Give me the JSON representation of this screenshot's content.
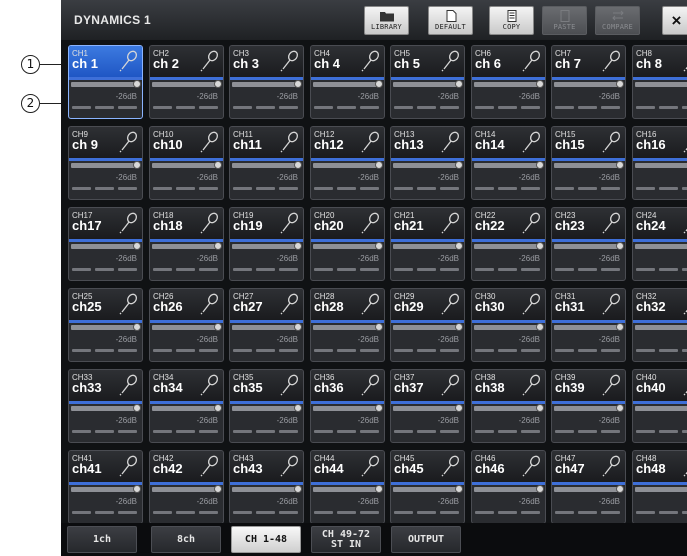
{
  "callouts": [
    "1",
    "2"
  ],
  "panel": {
    "title": "DYNAMICS 1"
  },
  "toolbar": {
    "buttons": [
      {
        "label": "LIBRARY",
        "icon": "folder-icon",
        "enabled": true
      },
      {
        "label": "DEFAULT",
        "icon": "document-icon",
        "enabled": true
      },
      {
        "label": "COPY",
        "icon": "clipboard-icon",
        "enabled": true
      },
      {
        "label": "PASTE",
        "icon": "paste-icon",
        "enabled": false
      },
      {
        "label": "COMPARE",
        "icon": "compare-icon",
        "enabled": false
      }
    ],
    "close_label": "×"
  },
  "channels": [
    {
      "id": "CH1",
      "name": "ch 1",
      "db": "-26dB",
      "selected": true
    },
    {
      "id": "CH2",
      "name": "ch 2",
      "db": "-26dB"
    },
    {
      "id": "CH3",
      "name": "ch 3",
      "db": "-26dB"
    },
    {
      "id": "CH4",
      "name": "ch 4",
      "db": "-26dB"
    },
    {
      "id": "CH5",
      "name": "ch 5",
      "db": "-26dB"
    },
    {
      "id": "CH6",
      "name": "ch 6",
      "db": "-26dB"
    },
    {
      "id": "CH7",
      "name": "ch 7",
      "db": "-26dB"
    },
    {
      "id": "CH8",
      "name": "ch 8",
      "db": "-26"
    },
    {
      "id": "CH9",
      "name": "ch 9",
      "db": "-26dB"
    },
    {
      "id": "CH10",
      "name": "ch10",
      "db": "-26dB"
    },
    {
      "id": "CH11",
      "name": "ch11",
      "db": "-26dB"
    },
    {
      "id": "CH12",
      "name": "ch12",
      "db": "-26dB"
    },
    {
      "id": "CH13",
      "name": "ch13",
      "db": "-26dB"
    },
    {
      "id": "CH14",
      "name": "ch14",
      "db": "-26dB"
    },
    {
      "id": "CH15",
      "name": "ch15",
      "db": "-26dB"
    },
    {
      "id": "CH16",
      "name": "ch16",
      "db": "-26"
    },
    {
      "id": "CH17",
      "name": "ch17",
      "db": "-26dB"
    },
    {
      "id": "CH18",
      "name": "ch18",
      "db": "-26dB"
    },
    {
      "id": "CH19",
      "name": "ch19",
      "db": "-26dB"
    },
    {
      "id": "CH20",
      "name": "ch20",
      "db": "-26dB"
    },
    {
      "id": "CH21",
      "name": "ch21",
      "db": "-26dB"
    },
    {
      "id": "CH22",
      "name": "ch22",
      "db": "-26dB"
    },
    {
      "id": "CH23",
      "name": "ch23",
      "db": "-26dB"
    },
    {
      "id": "CH24",
      "name": "ch24",
      "db": "-26"
    },
    {
      "id": "CH25",
      "name": "ch25",
      "db": "-26dB"
    },
    {
      "id": "CH26",
      "name": "ch26",
      "db": "-26dB"
    },
    {
      "id": "CH27",
      "name": "ch27",
      "db": "-26dB"
    },
    {
      "id": "CH28",
      "name": "ch28",
      "db": "-26dB"
    },
    {
      "id": "CH29",
      "name": "ch29",
      "db": "-26dB"
    },
    {
      "id": "CH30",
      "name": "ch30",
      "db": "-26dB"
    },
    {
      "id": "CH31",
      "name": "ch31",
      "db": "-26dB"
    },
    {
      "id": "CH32",
      "name": "ch32",
      "db": "-26"
    },
    {
      "id": "CH33",
      "name": "ch33",
      "db": "-26dB"
    },
    {
      "id": "CH34",
      "name": "ch34",
      "db": "-26dB"
    },
    {
      "id": "CH35",
      "name": "ch35",
      "db": "-26dB"
    },
    {
      "id": "CH36",
      "name": "ch36",
      "db": "-26dB"
    },
    {
      "id": "CH37",
      "name": "ch37",
      "db": "-26dB"
    },
    {
      "id": "CH38",
      "name": "ch38",
      "db": "-26dB"
    },
    {
      "id": "CH39",
      "name": "ch39",
      "db": "-26dB"
    },
    {
      "id": "CH40",
      "name": "ch40",
      "db": "-26"
    },
    {
      "id": "CH41",
      "name": "ch41",
      "db": "-26dB"
    },
    {
      "id": "CH42",
      "name": "ch42",
      "db": "-26dB"
    },
    {
      "id": "CH43",
      "name": "ch43",
      "db": "-26dB"
    },
    {
      "id": "CH44",
      "name": "ch44",
      "db": "-26dB"
    },
    {
      "id": "CH45",
      "name": "ch45",
      "db": "-26dB"
    },
    {
      "id": "CH46",
      "name": "ch46",
      "db": "-26dB"
    },
    {
      "id": "CH47",
      "name": "ch47",
      "db": "-26dB"
    },
    {
      "id": "CH48",
      "name": "ch48",
      "db": "-26"
    }
  ],
  "tabs": [
    {
      "label": "1ch",
      "active": false
    },
    {
      "label": "8ch",
      "active": false
    },
    {
      "label": "CH 1-48",
      "active": true
    },
    {
      "label": "CH 49-72\nST IN",
      "active": false
    },
    {
      "label": "OUTPUT",
      "active": false
    }
  ],
  "colors": {
    "selected_channel": "#2a62d4",
    "accent_line": "#3e6fd8",
    "background": "#101214"
  }
}
